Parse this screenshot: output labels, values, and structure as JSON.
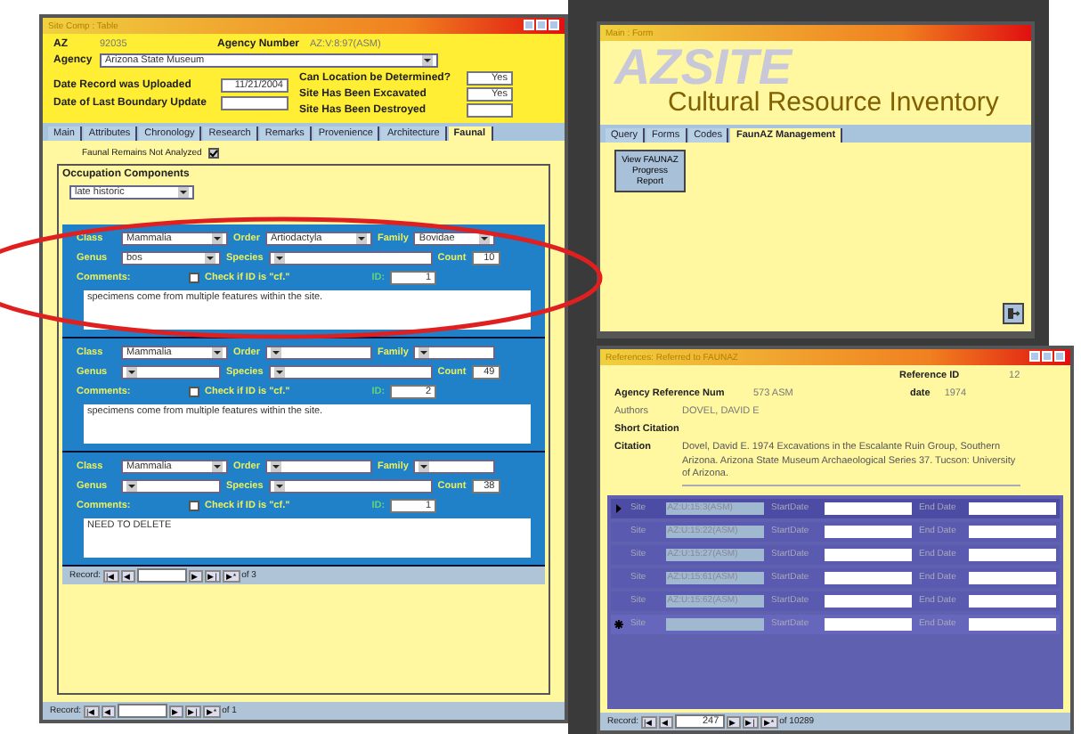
{
  "site_window": {
    "title": "Site Comp : Table",
    "header": {
      "az_label": "AZ",
      "az_value": "92035",
      "agency_number_label": "Agency Number",
      "agency_number": "AZ:V:8:97(ASM)",
      "agency_label": "Agency",
      "agency": "Arizona State Museum",
      "left_fields": [
        {
          "label": "Date Record was Uploaded",
          "value": "11/21/2004"
        },
        {
          "label": "Date of Last Boundary Update"
        }
      ],
      "right_fields": [
        {
          "label": "Can Location be Determined?",
          "value": "Yes"
        },
        {
          "label": "Site Has Been Excavated",
          "value": "Yes"
        },
        {
          "label": "Site Has Been Destroyed"
        }
      ]
    },
    "tabs": [
      {
        "label": "Main",
        "selected": false
      },
      {
        "label": "Attributes",
        "selected": false
      },
      {
        "label": "Chronology",
        "selected": false
      },
      {
        "label": "Research",
        "selected": false
      },
      {
        "label": "Remarks",
        "selected": false
      },
      {
        "label": "Provenience",
        "selected": false
      },
      {
        "label": "Architecture",
        "selected": false
      },
      {
        "label": "Faunal",
        "selected": true
      }
    ],
    "not_analyzed": {
      "label": "Faunal Remains Not Analyzed",
      "checked": true
    },
    "occupation": {
      "title": "Occupation Components",
      "value": "late historic"
    },
    "records": [
      {
        "circled": true,
        "fields": [
          {
            "label": "Class",
            "value": "Mammalia"
          },
          {
            "label": "Order",
            "value": "Artiodactyla"
          },
          {
            "label": "Family",
            "value": "Bovidae"
          },
          {
            "label": "Genus",
            "value": "bos"
          },
          {
            "label": "Species"
          },
          {
            "label": "Count",
            "value": "10"
          }
        ],
        "comments_label": "Comments:",
        "cf_label": "Check if ID is \"cf.\"",
        "cf_checked": false,
        "id_label": "ID:",
        "id": "1",
        "comments": "specimens come from multiple features within the site."
      },
      {
        "circled": false,
        "fields": [
          {
            "label": "Class",
            "value": "Mammalia"
          },
          {
            "label": "Order"
          },
          {
            "label": "Family"
          },
          {
            "label": "Genus"
          },
          {
            "label": "Species"
          },
          {
            "label": "Count",
            "value": "49"
          }
        ],
        "comments_label": "Comments:",
        "cf_label": "Check if ID is \"cf.\"",
        "cf_checked": false,
        "id_label": "ID:",
        "id": "2",
        "comments": "specimens come from multiple features within the site."
      },
      {
        "circled": false,
        "fields": [
          {
            "label": "Class",
            "value": "Mammalia"
          },
          {
            "label": "Order"
          },
          {
            "label": "Family"
          },
          {
            "label": "Genus"
          },
          {
            "label": "Species"
          },
          {
            "label": "Count",
            "value": "38"
          }
        ],
        "comments_label": "Comments:",
        "cf_label": "Check if ID is \"cf.\"",
        "cf_checked": false,
        "id_label": "ID:",
        "id": "1",
        "comments": "NEED TO DELETE"
      }
    ],
    "sub_nav": {
      "label": "Record:",
      "back": [
        "|◀",
        "◀"
      ],
      "forward": [
        "▶",
        "▶|",
        "▶*"
      ],
      "total": "of 3"
    },
    "nav": {
      "label": "Record:",
      "back": [
        "|◀",
        "◀"
      ],
      "forward": [
        "▶",
        "▶|",
        "▶*"
      ],
      "total": "of 1"
    }
  },
  "main_window": {
    "title": "Main : Form",
    "logo": "AZSITE",
    "heading": "Cultural Resource Inventory",
    "tabs": [
      {
        "label": "Query",
        "selected": false
      },
      {
        "label": "Forms",
        "selected": false
      },
      {
        "label": "Codes",
        "selected": false
      },
      {
        "label": "FaunAZ Management",
        "selected": true
      }
    ],
    "report_button": "View FAUNAZ Progress Report"
  },
  "ref_window": {
    "title": "References: Referred to FAUNAZ",
    "reference_id_label": "Reference ID",
    "reference_id": "12",
    "agency_ref_label": "Agency Reference Num",
    "agency_ref": "573 ASM",
    "date_label": "date",
    "date": "1974",
    "authors_label": "Authors",
    "authors": "DOVEL, DAVID E",
    "short_label": "Short Citation",
    "citation_label": "Citation",
    "citation": "Dovel, David E. 1974 Excavations in the Escalante Ruin Group, Southern Arizona. Arizona State Museum Archaeological Series 37. Tucson: University of Arizona.",
    "rows": [
      {
        "current": true,
        "new": false,
        "site_label": "Site",
        "site": "AZ:U:15:3(ASM)",
        "start_label": "StartDate",
        "end_label": "End Date"
      },
      {
        "current": false,
        "new": false,
        "site_label": "Site",
        "site": "AZ:U:15:22(ASM)",
        "start_label": "StartDate",
        "end_label": "End Date"
      },
      {
        "current": false,
        "new": false,
        "site_label": "Site",
        "site": "AZ:U:15:27(ASM)",
        "start_label": "StartDate",
        "end_label": "End Date"
      },
      {
        "current": false,
        "new": false,
        "site_label": "Site",
        "site": "AZ:U:15:61(ASM)",
        "start_label": "StartDate",
        "end_label": "End Date"
      },
      {
        "current": false,
        "new": false,
        "site_label": "Site",
        "site": "AZ:U:15:62(ASM)",
        "start_label": "StartDate",
        "end_label": "End Date"
      },
      {
        "current": false,
        "new": true,
        "site_label": "Site",
        "start_label": "StartDate",
        "end_label": "End Date"
      }
    ],
    "nav": {
      "label": "Record:",
      "back": [
        "|◀",
        "◀"
      ],
      "value": "247",
      "forward": [
        "▶",
        "▶|",
        "▶*"
      ],
      "total": "of 10289"
    }
  }
}
